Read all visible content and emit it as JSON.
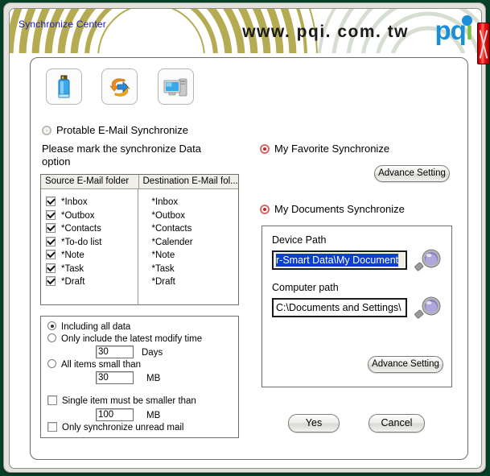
{
  "window": {
    "title": "Synchronize Center",
    "site_url": "www. pqi. com. tw",
    "brand_pq": "pq",
    "brand_i": "i",
    "close_label": "×"
  },
  "toolbar": {
    "buttons": [
      {
        "name": "device-icon",
        "label": "Device"
      },
      {
        "name": "sync-icon",
        "label": "Synchronize"
      },
      {
        "name": "computer-icon",
        "label": "Computer"
      }
    ]
  },
  "left": {
    "portable_option_label": "Protable E-Mail Synchronize",
    "instruction": "Please mark the synchronize Data option",
    "table": {
      "headers": [
        "Source E-Mail folder",
        "Destination E-Mail fol..."
      ],
      "source_items": [
        {
          "label": "*Inbox",
          "checked": true
        },
        {
          "label": "*Outbox",
          "checked": true
        },
        {
          "label": "*Contacts",
          "checked": true
        },
        {
          "label": "*To-do list",
          "checked": true
        },
        {
          "label": "*Note",
          "checked": true
        },
        {
          "label": "*Task",
          "checked": true
        },
        {
          "label": "*Draft",
          "checked": true
        }
      ],
      "destination_items": [
        "*Inbox",
        "*Outbox",
        "*Contacts",
        "*Calender",
        "*Note",
        "*Task",
        "*Draft"
      ]
    },
    "options": {
      "including_all_data": "Including all data",
      "latest_modify_time": "Only include the latest modify time",
      "days_value": "30",
      "days_unit": "Days",
      "all_items_small_than": "All items small than",
      "size_value": "30",
      "size_unit": "MB",
      "single_item_smaller": "Single item must be smaller than",
      "single_item_value": "100",
      "single_item_unit": "MB",
      "unread_only": "Only synchronize unread mail"
    }
  },
  "right": {
    "favorite_option_label": "My Favorite Synchronize",
    "documents_option_label": "My Documents Synchronize",
    "advance_setting_top": "Advance Setting",
    "advance_setting_bottom": "Advance Setting",
    "device_path_label": "Device Path",
    "device_path_value": "r-Smart Data\\My Document",
    "computer_path_label": "Computer path",
    "computer_path_value": "C:\\Documents and Settings\\"
  },
  "footer": {
    "yes_label": "Yes",
    "cancel_label": "Cancel"
  },
  "colors": {
    "banner_arc": "#b5ab52",
    "brand_blue": "#1a8fd8",
    "brand_green": "#7ac143",
    "title_blue": "#1d1dbb",
    "selection_blue": "#0a3fd0",
    "close_red": "#e81010",
    "desktop_green": "#054028"
  }
}
